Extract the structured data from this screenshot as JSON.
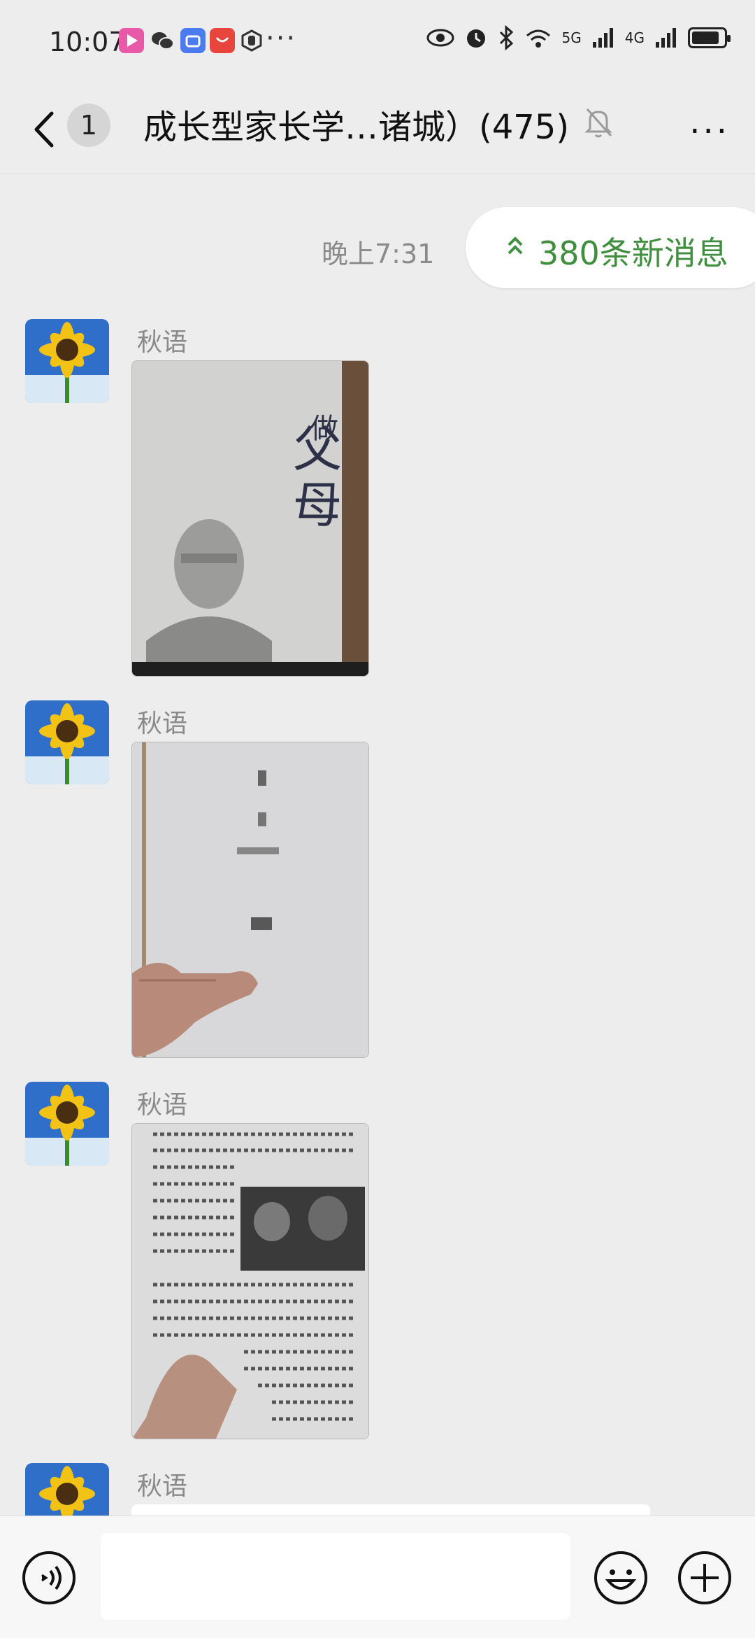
{
  "status_bar": {
    "time": "10:07",
    "more": "···",
    "network_5g": "5G",
    "network_4g": "4G",
    "battery_level": 0.75
  },
  "header": {
    "unread_count": "1",
    "title": "成长型家长学…诸城）(475)",
    "more": "···"
  },
  "timestamp": "晚上7:31",
  "new_messages": "380条新消息",
  "messages": [
    {
      "sender": "秋语",
      "type": "image"
    },
    {
      "sender": "秋语",
      "type": "image"
    },
    {
      "sender": "秋语",
      "type": "image"
    },
    {
      "sender": "秋语",
      "type": "text"
    }
  ],
  "colors": {
    "accent_green": "#3f8f3f",
    "background": "#ededed"
  }
}
